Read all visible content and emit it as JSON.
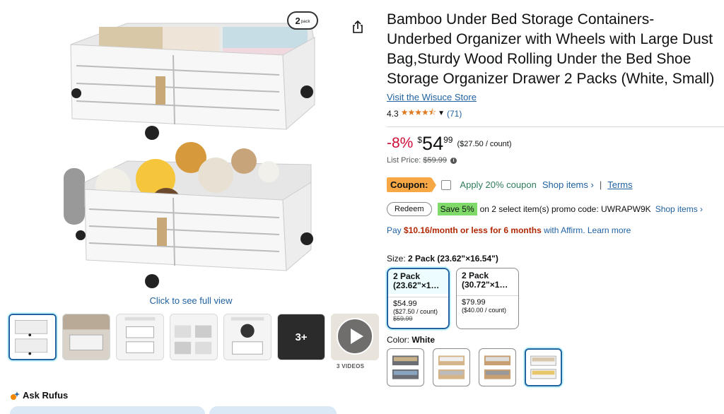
{
  "product": {
    "title": "Bamboo Under Bed Storage Containers-Underbed Organizer with Wheels with Large Dust Bag,Sturdy Wood Rolling Under the Bed Shoe Storage Organizer Drawer 2 Packs (White, Small)",
    "store_link": "Visit the Wisuce Store",
    "rating_value": "4.3",
    "rating_stars": "4.3 out of 5",
    "rating_count": "(71)"
  },
  "gallery": {
    "badge_number": "2",
    "badge_text": "pack",
    "click_to_view": "Click to see full view",
    "more_count": "3+",
    "videos_label": "3 VIDEOS",
    "thumbnails": [
      "main",
      "lifestyle",
      "product-dimensions",
      "considerate-details",
      "360-rotating-wheels",
      "more",
      "video"
    ]
  },
  "price": {
    "discount": "-8%",
    "currency": "$",
    "whole": "54",
    "fraction": "99",
    "unit_price": "($27.50 / count)",
    "list_price_label": "List Price:",
    "list_price": "$59.99"
  },
  "coupon": {
    "badge": "Coupon:",
    "apply_text": "Apply 20% coupon",
    "shop_items": "Shop items ›",
    "separator": "|",
    "terms": "Terms"
  },
  "promo": {
    "redeem_label": "Redeem",
    "save_badge": "Save 5%",
    "text": "on 2 select item(s) promo code: UWRAPW9K",
    "shop_items": "Shop items ›"
  },
  "affirm": {
    "prefix": "Pay",
    "amount": "$10.16/month or less for 6 months",
    "suffix": "with Affirm. Learn more"
  },
  "size": {
    "label": "Size:",
    "selected": "2 Pack (23.62\"×16.54\")",
    "options": [
      {
        "line1": "2 Pack",
        "line2": "(23.62\"×1…",
        "price": "$54.99",
        "unit": "($27.50 / count)",
        "strike": "$59.99"
      },
      {
        "line1": "2 Pack",
        "line2": "(30.72\"×1…",
        "price": "$79.99",
        "unit": "($40.00 / count)",
        "strike": ""
      }
    ]
  },
  "color": {
    "label": "Color:",
    "selected": "White",
    "options": [
      "gray",
      "natural-wood",
      "natural-wood-2",
      "white"
    ]
  },
  "rufus": {
    "label": "Ask Rufus"
  },
  "colors": {
    "link": "#2162a1",
    "discount": "#cc0c39",
    "star": "#de7921",
    "coupon_badge": "#f7a845",
    "save_badge": "#7fda69",
    "selected_border": "#2162a1"
  }
}
